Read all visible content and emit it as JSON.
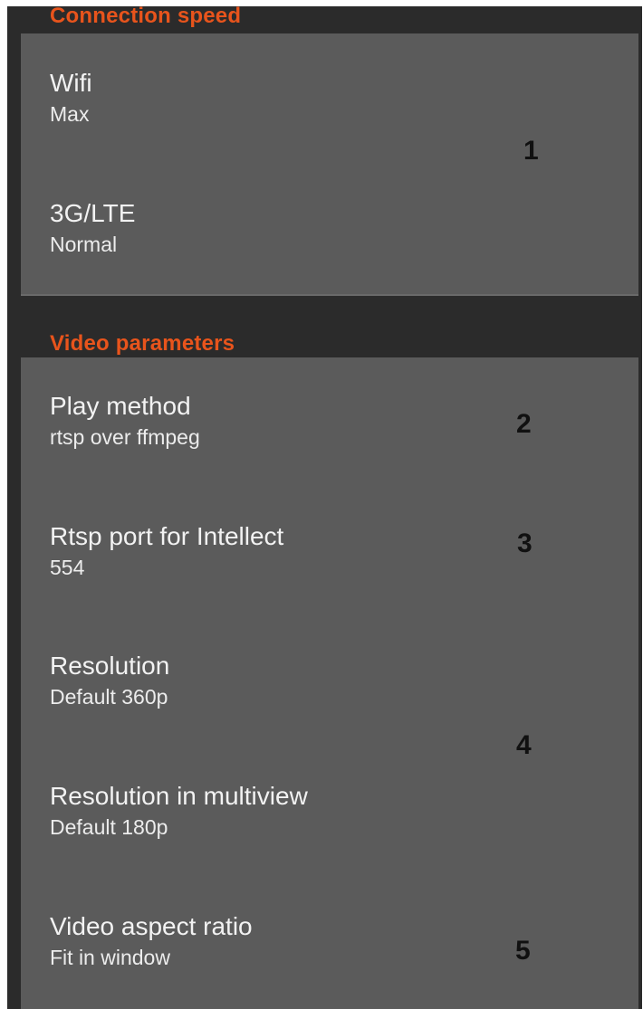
{
  "sections": [
    {
      "header": "Connection speed",
      "items": [
        {
          "title": "Wifi",
          "value": "Max"
        },
        {
          "title": "3G/LTE",
          "value": "Normal"
        }
      ]
    },
    {
      "header": "Video parameters",
      "items": [
        {
          "title": "Play method",
          "value": "rtsp over ffmpeg"
        },
        {
          "title": "Rtsp port for Intellect",
          "value": "554"
        },
        {
          "title": "Resolution",
          "value": "Default 360p"
        },
        {
          "title": "Resolution in multiview",
          "value": "Default 180p"
        },
        {
          "title": "Video aspect ratio",
          "value": "Fit in window"
        }
      ]
    }
  ],
  "markers": [
    "1",
    "2",
    "3",
    "4",
    "5"
  ],
  "colors": {
    "header": "#e8541c",
    "background": "#2b2b2b",
    "panel": "#5b5b5b",
    "text": "#f2f2f2",
    "marker": "#111111"
  }
}
